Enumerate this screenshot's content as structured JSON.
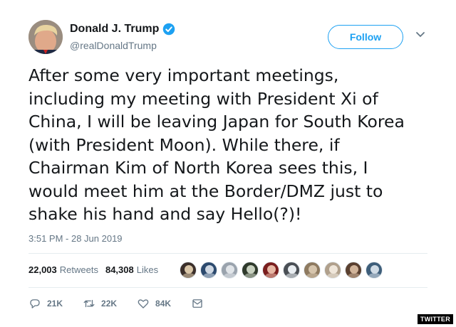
{
  "author": {
    "display_name": "Donald J. Trump",
    "handle": "@realDonaldTrump",
    "verified": true
  },
  "follow_button": {
    "label": "Follow"
  },
  "tweet": {
    "text": "After some very important meetings,\nincluding my meeting with President Xi of\nChina, I will be leaving Japan for South Korea\n(with President Moon). While there, if\nChairman Kim of North Korea sees this, I\nwould meet him at the Border/DMZ just to\nshake his hand and say Hello(?)!",
    "timestamp": "3:51 PM - 28 Jun 2019"
  },
  "stats": {
    "retweets_count": "22,003",
    "retweets_label": "Retweets",
    "likes_count": "84,308",
    "likes_label": "Likes"
  },
  "likers": [
    {
      "color": "#3b2f2a",
      "accent": "#d9c6a8"
    },
    {
      "color": "#2c4a6e",
      "accent": "#cfd8e3"
    },
    {
      "color": "#9aa3ad",
      "accent": "#e1e5e9"
    },
    {
      "color": "#2f3a2c",
      "accent": "#c8d1c0"
    },
    {
      "color": "#7a1e1e",
      "accent": "#e7b8a5"
    },
    {
      "color": "#4a4f55",
      "accent": "#e9eef2"
    },
    {
      "color": "#8e7a60",
      "accent": "#d6c5ad"
    },
    {
      "color": "#b0a08c",
      "accent": "#efe6da"
    },
    {
      "color": "#5a4030",
      "accent": "#d1b49a"
    },
    {
      "color": "#3e5e7a",
      "accent": "#d0dbe5"
    }
  ],
  "actions": {
    "reply_count": "21K",
    "retweet_count": "22K",
    "like_count": "84K"
  },
  "icons": {
    "reply": "reply-icon",
    "retweet": "retweet-icon",
    "like": "heart-icon",
    "message": "direct-message-icon",
    "verified": "verified-badge-icon",
    "caret": "chevron-down-icon"
  },
  "colors": {
    "accent": "#1da1f2",
    "secondary_text": "#657786",
    "divider": "#e6ecf0"
  },
  "watermark": "TWITTER"
}
